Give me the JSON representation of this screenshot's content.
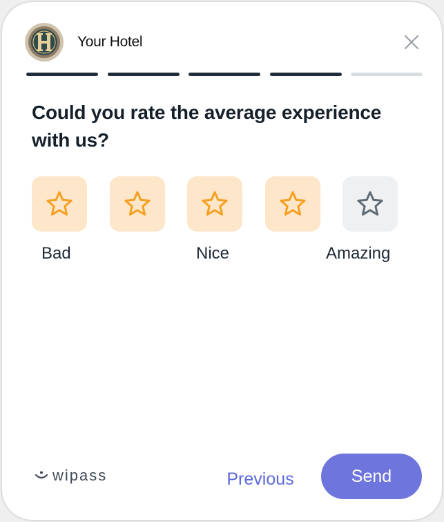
{
  "header": {
    "hotel_name": "Your Hotel",
    "avatar_icon": "hotel-monogram-logo",
    "close_icon": "close-icon"
  },
  "progress": {
    "total_steps": 5,
    "completed_steps": 4,
    "active_color": "#1f2d3a",
    "inactive_color": "#d9dde0"
  },
  "question": "Could you rate the average experience with us?",
  "rating": {
    "max": 5,
    "selected": 4,
    "star_icon": "star-icon",
    "active_star_color": "#f5a020",
    "active_bg": "#fde6c9",
    "inactive_star_color": "#5f6b75",
    "inactive_bg": "#eef0f1",
    "labels": {
      "low": "Bad",
      "mid": "Nice",
      "high": "Amazing"
    }
  },
  "footer": {
    "brand": "wipass",
    "brand_icon": "smile-icon",
    "previous_label": "Previous",
    "send_label": "Send",
    "accent": "#6e76dd"
  }
}
